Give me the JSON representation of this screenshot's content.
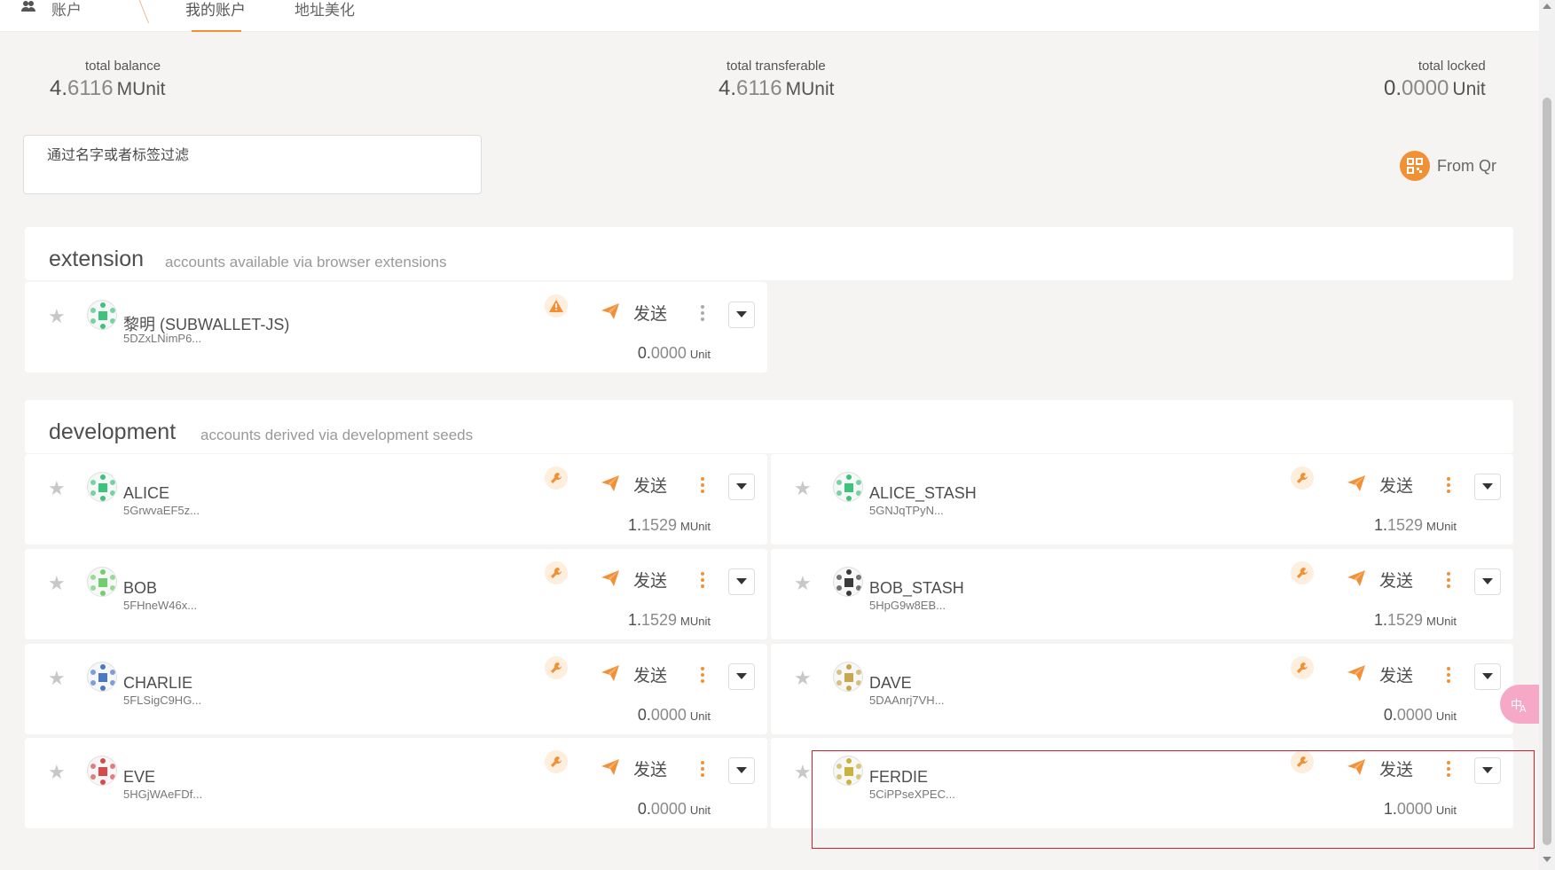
{
  "header": {
    "app_title": "账户",
    "tabs": [
      {
        "label": "我的账户",
        "active": true
      },
      {
        "label": "地址美化",
        "active": false
      }
    ]
  },
  "summary": {
    "total_balance": {
      "label": "total balance",
      "int": "4.",
      "dec": "6116",
      "unit": "MUnit"
    },
    "total_transferable": {
      "label": "total transferable",
      "int": "4.",
      "dec": "6116",
      "unit": "MUnit"
    },
    "total_locked": {
      "label": "total locked",
      "int": "0.",
      "dec": "0000",
      "unit": "Unit"
    }
  },
  "filter": {
    "label": "通过名字或者标签过滤",
    "value": ""
  },
  "from_qr": {
    "label": "From Qr"
  },
  "send_label": "发送",
  "sections": {
    "extension": {
      "title": "extension",
      "desc": "accounts available via browser extensions",
      "accounts": [
        {
          "name": "黎明 (SUBWALLET-JS)",
          "address": "5DZxLNimP6...",
          "badge": "warning-icon",
          "int": "0.",
          "dec": "0000",
          "unit": "Unit",
          "avatar_color": "#3cc47c"
        }
      ]
    },
    "development": {
      "title": "development",
      "desc": "accounts derived via development seeds",
      "accounts": [
        {
          "name": "ALICE",
          "address": "5GrwvaEF5z...",
          "badge": "wrench-icon",
          "int": "1.",
          "dec": "1529",
          "unit": "MUnit",
          "avatar_color": "#3cc47c"
        },
        {
          "name": "ALICE_STASH",
          "address": "5GNJqTPyN...",
          "badge": "wrench-icon",
          "int": "1.",
          "dec": "1529",
          "unit": "MUnit",
          "avatar_color": "#3cc47c"
        },
        {
          "name": "BOB",
          "address": "5FHneW46x...",
          "badge": "wrench-icon",
          "int": "1.",
          "dec": "1529",
          "unit": "MUnit",
          "avatar_color": "#6fcf6f"
        },
        {
          "name": "BOB_STASH",
          "address": "5HpG9w8EB...",
          "badge": "wrench-icon",
          "int": "1.",
          "dec": "1529",
          "unit": "MUnit",
          "avatar_color": "#3a3a3a"
        },
        {
          "name": "CHARLIE",
          "address": "5FLSigC9HG...",
          "badge": "wrench-icon",
          "int": "0.",
          "dec": "0000",
          "unit": "Unit",
          "avatar_color": "#4a78c8"
        },
        {
          "name": "DAVE",
          "address": "5DAAnrj7VH...",
          "badge": "wrench-icon",
          "int": "0.",
          "dec": "0000",
          "unit": "Unit",
          "avatar_color": "#c8a84a"
        },
        {
          "name": "EVE",
          "address": "5HGjWAeFDf...",
          "badge": "wrench-icon",
          "int": "0.",
          "dec": "0000",
          "unit": "Unit",
          "avatar_color": "#d84a4a"
        },
        {
          "name": "FERDIE",
          "address": "5CiPPseXPEC...",
          "badge": "wrench-icon",
          "int": "1.",
          "dec": "0000",
          "unit": "Unit",
          "avatar_color": "#c8b43a"
        }
      ]
    }
  },
  "colors": {
    "accent": "#f19135",
    "highlight": "#d21f2c",
    "star": "#c8c8c8"
  }
}
